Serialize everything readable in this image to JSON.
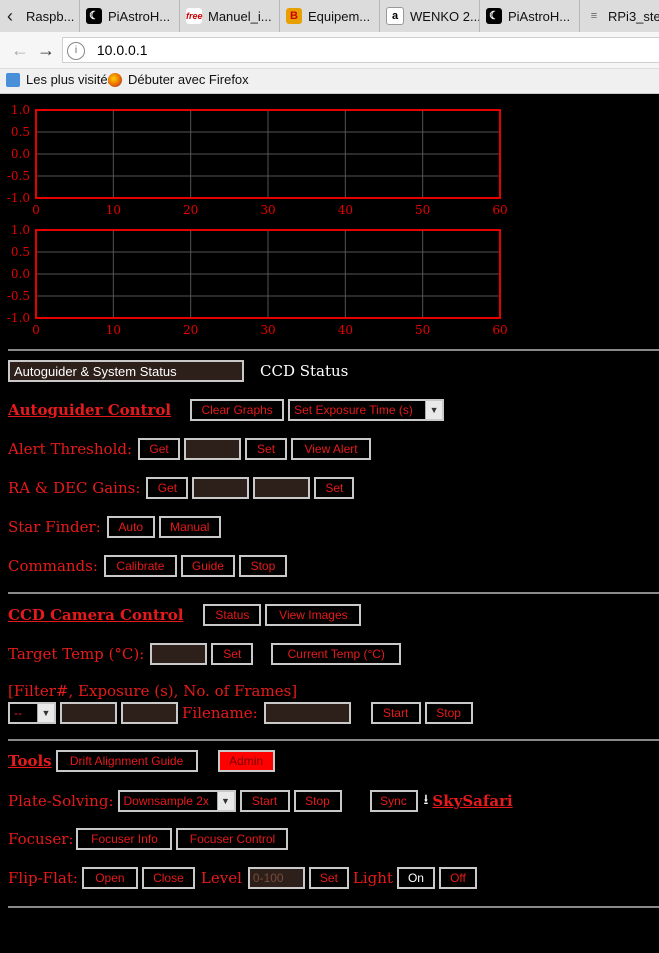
{
  "browser": {
    "tabs": [
      {
        "label": "Raspb...",
        "icon": "raspberry-icon"
      },
      {
        "label": "PiAstroH...",
        "icon": "moon-icon"
      },
      {
        "label": "Manuel_i...",
        "icon": "free-icon"
      },
      {
        "label": "Equipem...",
        "icon": "bold-b-icon"
      },
      {
        "label": "WENKO 2...",
        "icon": "amazon-icon"
      },
      {
        "label": "PiAstroH...",
        "icon": "moon-icon"
      },
      {
        "label": "RPi3_step",
        "icon": "file-icon"
      }
    ],
    "url": "10.0.0.1",
    "bookmarks": [
      "Les plus visités",
      "Débuter avec Firefox"
    ]
  },
  "charts": [
    {
      "yticks": [
        "1.0",
        "0.5",
        "0.0",
        "-0.5",
        "-1.0"
      ],
      "xticks": [
        "0",
        "10",
        "20",
        "30",
        "40",
        "50",
        "60"
      ]
    },
    {
      "yticks": [
        "1.0",
        "0.5",
        "0.0",
        "-0.5",
        "-1.0"
      ],
      "xticks": [
        "0",
        "10",
        "20",
        "30",
        "40",
        "50",
        "60"
      ]
    }
  ],
  "chart_data": [
    {
      "type": "line",
      "title": "",
      "xlabel": "",
      "ylabel": "",
      "xlim": [
        0,
        60
      ],
      "ylim": [
        -1.0,
        1.0
      ],
      "grid": true,
      "series": []
    },
    {
      "type": "line",
      "title": "",
      "xlabel": "",
      "ylabel": "",
      "xlim": [
        0,
        60
      ],
      "ylim": [
        -1.0,
        1.0
      ],
      "grid": true,
      "series": []
    }
  ],
  "status": {
    "select_value": "Autoguider & System Status",
    "ccd_status_label": "CCD Status"
  },
  "autoguider": {
    "heading": "Autoguider Control",
    "clear_graphs": "Clear Graphs",
    "exposure_select": "Set Exposure Time (s)",
    "alert_label": "Alert Threshold:",
    "alert_get": "Get",
    "alert_set": "Set",
    "view_alert": "View Alert",
    "gains_label": "RA & DEC Gains:",
    "gains_get": "Get",
    "gains_set": "Set",
    "star_finder_label": "Star Finder:",
    "auto": "Auto",
    "manual": "Manual",
    "commands_label": "Commands:",
    "calibrate": "Calibrate",
    "guide": "Guide",
    "stop": "Stop"
  },
  "ccd": {
    "heading": "CCD Camera Control",
    "status": "Status",
    "view_images": "View Images",
    "target_temp_label": "Target Temp (°C):",
    "set": "Set",
    "current_temp": "Current Temp (°C)",
    "filter_label": "[Filter#, Exposure (s), No. of Frames]",
    "filter_select": "--",
    "filename_label": "Filename:",
    "start": "Start",
    "stop": "Stop"
  },
  "tools": {
    "heading": "Tools",
    "drift": "Drift Alignment Guide",
    "admin": "Admin",
    "admin_color": "#ff0000",
    "plate_label": "Plate-Solving:",
    "downsample": "Downsample 2x",
    "start": "Start",
    "stop": "Stop",
    "sync": "Sync",
    "skysafari": "SkySafari",
    "focuser_label": "Focuser:",
    "focuser_info": "Focuser Info",
    "focuser_control": "Focuser Control",
    "flip_label": "Flip-Flat:",
    "open": "Open",
    "close": "Close",
    "level_label": "Level",
    "level_placeholder": "0-100",
    "level_set": "Set",
    "light_label": "Light",
    "on": "On",
    "off": "Off"
  }
}
